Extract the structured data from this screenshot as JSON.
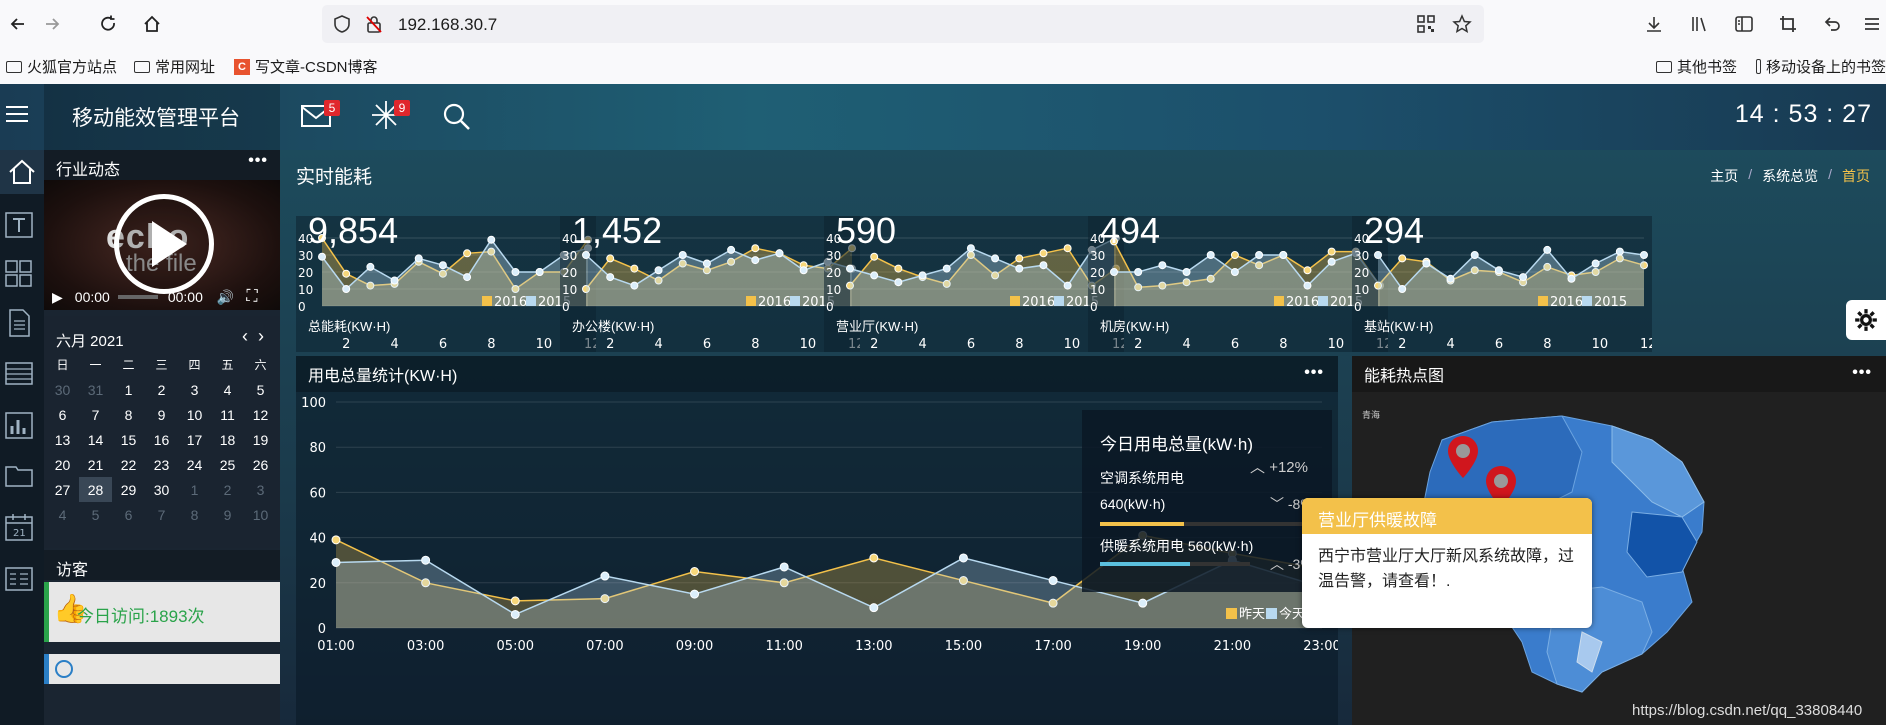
{
  "browser": {
    "url": "192.168.30.7",
    "bookmarks": [
      "火狐官方站点",
      "常用网址",
      "写文章-CSDN博客"
    ],
    "bookmarks_right": [
      "其他书签",
      "移动设备上的书签"
    ]
  },
  "app": {
    "title": "移动能效管理平台",
    "clock": "14 : 53 : 27",
    "mail_badge": "5",
    "alert_badge": "9",
    "page_title": "实时能耗",
    "breadcrumb": [
      "主页",
      "系统总览",
      "首页"
    ],
    "breadcrumb_sep": "/"
  },
  "sidebar": {
    "news_title": "行业动态",
    "video": {
      "time_current": "00:00",
      "time_total": "00:00",
      "overlay_text_1": "echo",
      "overlay_text_2": "the file"
    },
    "calendar": {
      "month": "六月 2021",
      "weekdays": [
        "日",
        "一",
        "二",
        "三",
        "四",
        "五",
        "六"
      ],
      "rows": [
        [
          "30",
          "31",
          "1",
          "2",
          "3",
          "4",
          "5"
        ],
        [
          "6",
          "7",
          "8",
          "9",
          "10",
          "11",
          "12"
        ],
        [
          "13",
          "14",
          "15",
          "16",
          "17",
          "18",
          "19"
        ],
        [
          "20",
          "21",
          "22",
          "23",
          "24",
          "25",
          "26"
        ],
        [
          "27",
          "28",
          "29",
          "30",
          "1",
          "2",
          "3"
        ],
        [
          "4",
          "5",
          "6",
          "7",
          "8",
          "9",
          "10"
        ]
      ],
      "muted": [
        [
          0,
          0
        ],
        [
          0,
          1
        ],
        [
          4,
          4
        ],
        [
          4,
          5
        ],
        [
          4,
          6
        ],
        [
          5,
          0
        ],
        [
          5,
          1
        ],
        [
          5,
          2
        ],
        [
          5,
          3
        ],
        [
          5,
          4
        ],
        [
          5,
          5
        ],
        [
          5,
          6
        ]
      ],
      "today": [
        4,
        1
      ]
    },
    "visitor_title": "访客",
    "visits_today": "今日访问:1893次"
  },
  "kpis": [
    {
      "value": "9,854",
      "label": "总能耗(KW·H)"
    },
    {
      "value": "1,452",
      "label": "办公楼(KW·H)"
    },
    {
      "value": "590",
      "label": "营业厅(KW·H)"
    },
    {
      "value": "494",
      "label": "机房(KW·H)"
    },
    {
      "value": "294",
      "label": "基站(KW·H)"
    }
  ],
  "kpi_chart": {
    "y_ticks": [
      "40",
      "30",
      "20",
      "10",
      "0"
    ],
    "x_ticks": [
      "2",
      "4",
      "6",
      "8",
      "10",
      "12"
    ],
    "legend": [
      "2016",
      "2015"
    ]
  },
  "main_chart_title": "用电总量统计(KW·H)",
  "summary": {
    "title": "今日用电总量(kW·h)",
    "total_change": "+12%",
    "ac_label": "空调系统用电",
    "ac_value": "640(kW·h)",
    "ac_change": "-8%",
    "heat_label": "供暖系统用电",
    "heat_value": "560(kW·h)",
    "heat_change": "-3%"
  },
  "heatmap": {
    "title": "能耗热点图",
    "region_label": "青海",
    "tooltip_title": "营业厅供暖故障",
    "tooltip_body": "西宁市营业厅大厅新风系统故障，过温告警，请查看！."
  },
  "watermark": "https://blog.csdn.net/qq_33808440",
  "colors": {
    "accent_yellow": "#f3c14a",
    "accent_blue": "#b8d9ef",
    "brand_bg": "#1b4a62",
    "badge_red": "#e0272c",
    "green_icon": "#2aa34a"
  },
  "chart_data": [
    {
      "type": "line",
      "title": "",
      "series": [
        {
          "name": "2016",
          "values": [
            40,
            19,
            12,
            13,
            26,
            19,
            31,
            32,
            10,
            20,
            20,
            39
          ]
        },
        {
          "name": "2015",
          "values": [
            29,
            10,
            23,
            15,
            28,
            24,
            17,
            39,
            20,
            20,
            30,
            34
          ]
        }
      ],
      "x": [
        1,
        2,
        3,
        4,
        5,
        6,
        7,
        8,
        9,
        10,
        11,
        12
      ],
      "ylim": [
        0,
        40
      ]
    },
    {
      "type": "line",
      "title": "",
      "series": [
        {
          "name": "2016",
          "values": [
            10,
            28,
            22,
            15,
            25,
            21,
            26,
            34,
            31,
            24,
            22,
            34
          ]
        },
        {
          "name": "2015",
          "values": [
            30,
            17,
            12,
            21,
            30,
            25,
            33,
            27,
            31,
            21,
            26,
            22
          ]
        }
      ],
      "x": [
        1,
        2,
        3,
        4,
        5,
        6,
        7,
        8,
        9,
        10,
        11,
        12
      ],
      "ylim": [
        0,
        40
      ]
    },
    {
      "type": "line",
      "title": "",
      "series": [
        {
          "name": "2016",
          "values": [
            12,
            29,
            22,
            17,
            13,
            30,
            18,
            28,
            31,
            34,
            12,
            22
          ]
        },
        {
          "name": "2015",
          "values": [
            22,
            18,
            14,
            18,
            22,
            34,
            28,
            22,
            24,
            12,
            33,
            40
          ]
        }
      ],
      "x": [
        1,
        2,
        3,
        4,
        5,
        6,
        7,
        8,
        9,
        10,
        11,
        12
      ],
      "ylim": [
        0,
        40
      ]
    },
    {
      "type": "line",
      "title": "",
      "series": [
        {
          "name": "2016",
          "values": [
            38,
            11,
            12,
            14,
            16,
            30,
            24,
            30,
            21,
            32,
            32,
            12
          ]
        },
        {
          "name": "2015",
          "values": [
            20,
            20,
            24,
            20,
            30,
            20,
            30,
            30,
            12,
            26,
            31,
            12
          ]
        }
      ],
      "x": [
        1,
        2,
        3,
        4,
        5,
        6,
        7,
        8,
        9,
        10,
        11,
        12
      ],
      "ylim": [
        0,
        40
      ]
    },
    {
      "type": "line",
      "title": "",
      "series": [
        {
          "name": "2016",
          "values": [
            12,
            28,
            26,
            15,
            21,
            20,
            14,
            23,
            18,
            20,
            28,
            24
          ]
        },
        {
          "name": "2015",
          "values": [
            30,
            10,
            25,
            16,
            30,
            21,
            17,
            33,
            16,
            25,
            32,
            30
          ]
        }
      ],
      "x": [
        1,
        2,
        3,
        4,
        5,
        6,
        7,
        8,
        9,
        10,
        11,
        12
      ],
      "ylim": [
        0,
        40
      ]
    },
    {
      "type": "area",
      "title": "用电总量统计(KW·H)",
      "categories": [
        "01:00",
        "03:00",
        "05:00",
        "07:00",
        "09:00",
        "11:00",
        "13:00",
        "15:00",
        "17:00",
        "19:00",
        "21:00",
        "23:00"
      ],
      "series": [
        {
          "name": "昨天",
          "values": [
            39,
            20,
            12,
            13,
            25,
            20,
            31,
            21,
            11,
            41,
            33,
            26
          ]
        },
        {
          "name": "今天",
          "values": [
            29,
            30,
            6,
            23,
            15,
            27,
            9,
            31,
            21,
            11,
            30,
            18
          ]
        }
      ],
      "ylim": [
        0,
        100
      ],
      "y_ticks": [
        0,
        20,
        40,
        60,
        80,
        100
      ]
    }
  ]
}
